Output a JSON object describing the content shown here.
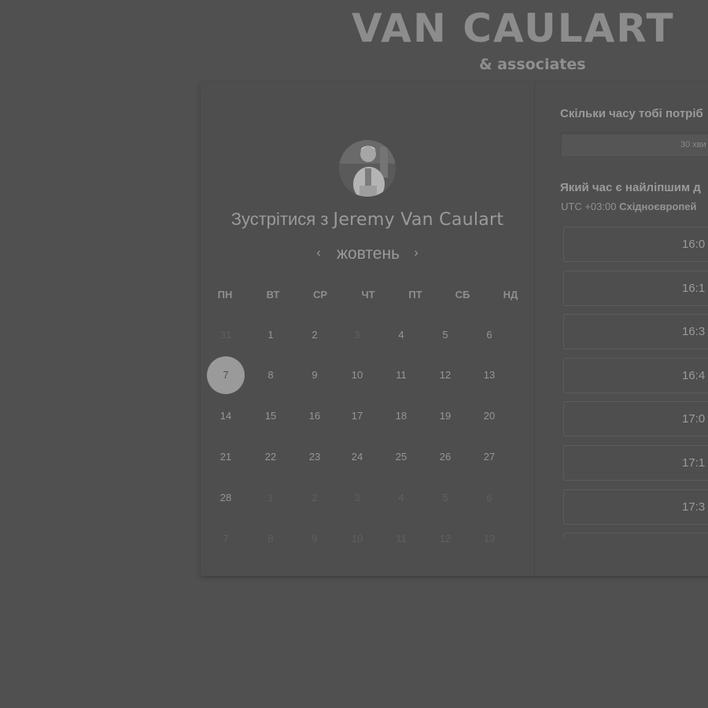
{
  "brand": {
    "title": "VAN CAULART",
    "subtitle": "& associates"
  },
  "left": {
    "title_prefix": "Зустрітися з",
    "host_name": "Jeremy Van Caulart",
    "prev_month_icon": "chevron-left-icon",
    "next_month_icon": "chevron-right-icon",
    "prev_symbol": "‹",
    "next_symbol": "›",
    "month": "жовтень",
    "weekdays": [
      "ПН",
      "ВТ",
      "СР",
      "ЧТ",
      "ПТ",
      "СБ",
      "НД"
    ],
    "weeks": [
      [
        "31",
        "1",
        "2",
        "3",
        "4",
        "5",
        "6"
      ],
      [
        "7",
        "8",
        "9",
        "10",
        "11",
        "12",
        "13"
      ],
      [
        "14",
        "15",
        "16",
        "17",
        "18",
        "19",
        "20"
      ],
      [
        "21",
        "22",
        "23",
        "24",
        "25",
        "26",
        "27"
      ],
      [
        "28",
        "1",
        "2",
        "3",
        "4",
        "5",
        "6"
      ],
      [
        "7",
        "8",
        "9",
        "10",
        "11",
        "12",
        "13"
      ]
    ],
    "muted_days": [
      [
        0,
        0
      ],
      [
        0,
        3
      ],
      [
        4,
        1
      ],
      [
        4,
        2
      ],
      [
        4,
        3
      ],
      [
        4,
        4
      ],
      [
        4,
        5
      ],
      [
        4,
        6
      ],
      [
        5,
        0
      ],
      [
        5,
        1
      ],
      [
        5,
        2
      ],
      [
        5,
        3
      ],
      [
        5,
        4
      ],
      [
        5,
        5
      ],
      [
        5,
        6
      ]
    ],
    "selected_day": [
      1,
      0
    ]
  },
  "right": {
    "duration_question": "Скільки часу тобі потріб",
    "duration_value": "30 хви",
    "time_question": "Який час є найліпшим д",
    "timezone_offset": "UTC +03:00",
    "timezone_name": "Східноєвропей",
    "slots": [
      "16:0",
      "16:1",
      "16:3",
      "16:4",
      "17:0",
      "17:1",
      "17:3",
      ""
    ]
  },
  "colors": {
    "background": "#505050",
    "card": "#4e4e4e",
    "selected_day": "#9a9a9a"
  }
}
